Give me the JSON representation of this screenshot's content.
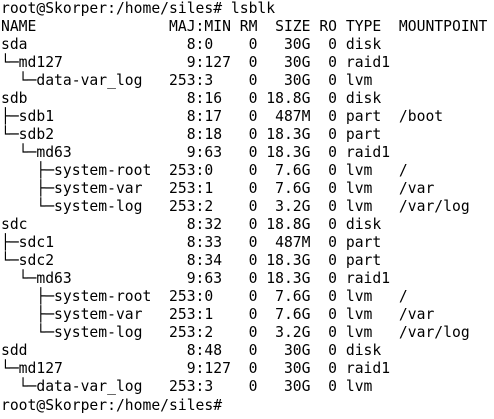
{
  "terminal": {
    "prompt_line": "root@Skorper:/home/siles# lsblk",
    "header": "NAME               MAJ:MIN RM  SIZE RO TYPE  MOUNTPOINT",
    "rows": [
      "sda                  8:0    0   30G  0 disk",
      "└─md127              9:127  0   30G  0 raid1",
      "  └─data-var_log   253:3    0   30G  0 lvm",
      "sdb                  8:16   0 18.8G  0 disk",
      "├─sdb1               8:17   0  487M  0 part  /boot",
      "└─sdb2               8:18   0 18.3G  0 part",
      "  └─md63             9:63   0 18.3G  0 raid1",
      "    ├─system-root  253:0    0  7.6G  0 lvm   /",
      "    ├─system-var   253:1    0  7.6G  0 lvm   /var",
      "    └─system-log   253:2    0  3.2G  0 lvm   /var/log",
      "sdc                  8:32   0 18.8G  0 disk",
      "├─sdc1               8:33   0  487M  0 part",
      "└─sdc2               8:34   0 18.3G  0 part",
      "  └─md63             9:63   0 18.3G  0 raid1",
      "    ├─system-root  253:0    0  7.6G  0 lvm   /",
      "    ├─system-var   253:1    0  7.6G  0 lvm   /var",
      "    └─system-log   253:2    0  3.2G  0 lvm   /var/log",
      "sdd                  8:48   0   30G  0 disk",
      "└─md127              9:127  0   30G  0 raid1",
      "  └─data-var_log   253:3    0   30G  0 lvm"
    ],
    "final_prompt": "root@Skorper:/home/siles# "
  }
}
